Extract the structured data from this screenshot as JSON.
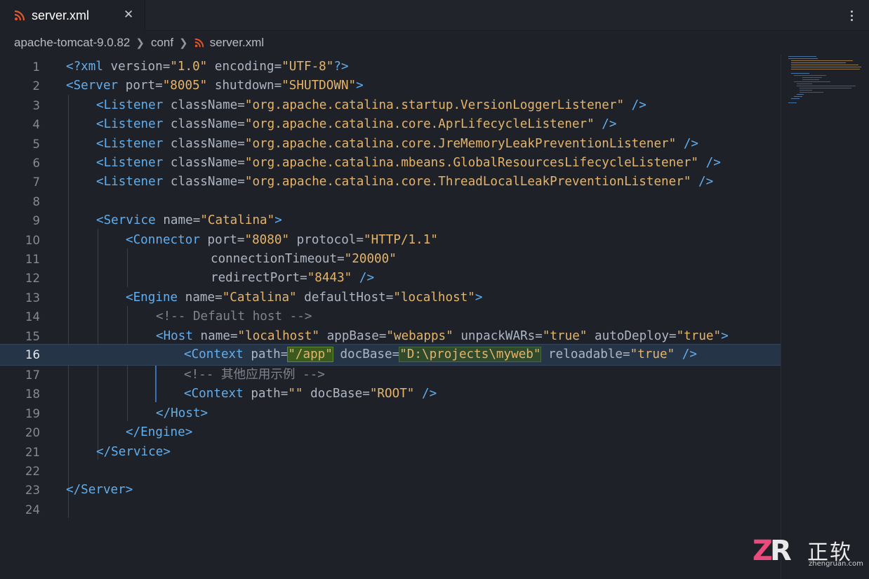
{
  "tab": {
    "title": "server.xml",
    "icon": "rss-xml-file-icon",
    "close_glyph": "✕",
    "icon_color": "#e4572e"
  },
  "breadcrumb": {
    "items": [
      "apache-tomcat-9.0.82",
      "conf",
      "server.xml"
    ]
  },
  "editor": {
    "active_line": 16,
    "lines": [
      {
        "n": "1"
      },
      {
        "n": "2"
      },
      {
        "n": "3"
      },
      {
        "n": "4"
      },
      {
        "n": "5"
      },
      {
        "n": "6"
      },
      {
        "n": "7"
      },
      {
        "n": "8"
      },
      {
        "n": "9"
      },
      {
        "n": "10"
      },
      {
        "n": "11"
      },
      {
        "n": "12"
      },
      {
        "n": "13"
      },
      {
        "n": "14"
      },
      {
        "n": "15"
      },
      {
        "n": "16"
      },
      {
        "n": "17"
      },
      {
        "n": "18"
      },
      {
        "n": "19"
      },
      {
        "n": "20"
      },
      {
        "n": "21"
      },
      {
        "n": "22"
      },
      {
        "n": "23"
      },
      {
        "n": "24"
      }
    ],
    "code": {
      "l1": {
        "a": "<?xml",
        "b": " version",
        "c": "=",
        "d": "\"1.0\"",
        "e": " encoding",
        "f": "=",
        "g": "\"UTF-8\"",
        "h": "?>"
      },
      "l2": {
        "a": "<Server",
        "b": " port",
        "d": "\"8005\"",
        "e": " shutdown",
        "g": "\"SHUTDOWN\"",
        "h": ">"
      },
      "l3": {
        "a": "<Listener",
        "b": " className",
        "d": "\"org.apache.catalina.startup.VersionLoggerListener\"",
        "h": " />"
      },
      "l4": {
        "a": "<Listener",
        "b": " className",
        "d": "\"org.apache.catalina.core.AprLifecycleListener\"",
        "h": " />"
      },
      "l5": {
        "a": "<Listener",
        "b": " className",
        "d": "\"org.apache.catalina.core.JreMemoryLeakPreventionListener\"",
        "h": " />"
      },
      "l6": {
        "a": "<Listener",
        "b": " className",
        "d": "\"org.apache.catalina.mbeans.GlobalResourcesLifecycleListener\"",
        "h": " />"
      },
      "l7": {
        "a": "<Listener",
        "b": " className",
        "d": "\"org.apache.catalina.core.ThreadLocalLeakPreventionListener\"",
        "h": " />"
      },
      "l9": {
        "a": "<Service",
        "b": " name",
        "d": "\"Catalina\"",
        "h": ">"
      },
      "l10": {
        "a": "<Connector",
        "b": " port",
        "d": "\"8080\"",
        "e": " protocol",
        "g": "\"HTTP/1.1\""
      },
      "l11": {
        "b": "connectionTimeout",
        "d": "\"20000\""
      },
      "l12": {
        "b": "redirectPort",
        "d": "\"8443\"",
        "h": " />"
      },
      "l13": {
        "a": "<Engine",
        "b": " name",
        "d": "\"Catalina\"",
        "e": " defaultHost",
        "g": "\"localhost\"",
        "h": ">"
      },
      "l14": {
        "com": "<!-- Default host -->"
      },
      "l15": {
        "a": "<Host",
        "b": " name",
        "d": "\"localhost\"",
        "e": " appBase",
        "g": "\"webapps\"",
        "i": " unpackWARs",
        "j": "\"true\"",
        "k": " autoDeploy",
        "l": "\"true\"",
        "h": ">"
      },
      "l16": {
        "a": "<Context",
        "b": " path",
        "d": "\"/app\"",
        "e": " docBase",
        "g": "\"D:\\projects\\myweb\"",
        "i": " reloadable",
        "j": "\"true\"",
        "h": " />"
      },
      "l17": {
        "com": "<!-- 其他应用示例 -->"
      },
      "l18": {
        "a": "<Context",
        "b": " path",
        "d": "\"\"",
        "e": " docBase",
        "g": "\"ROOT\"",
        "h": " />"
      },
      "l19": {
        "a": "</Host>"
      },
      "l20": {
        "a": "</Engine>"
      },
      "l21": {
        "a": "</Service>"
      },
      "l23": {
        "a": "</Server>"
      }
    },
    "eq": "="
  },
  "watermark": {
    "logo_z": "Z",
    "logo_r": "R",
    "name": "正软",
    "url": "zhengruan.com"
  }
}
